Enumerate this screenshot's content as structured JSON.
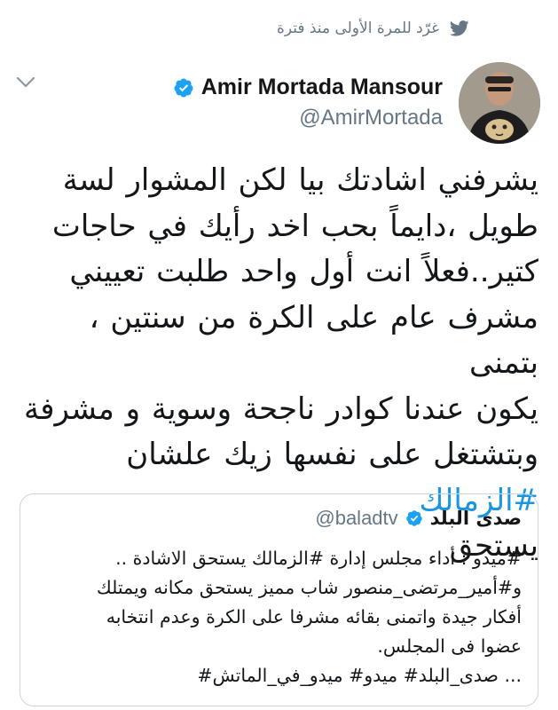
{
  "banner": {
    "text": "غرّد للمرة الأولى منذ فترة",
    "icon": "twitter-bird-icon"
  },
  "author": {
    "name": "Amir Mortada Mansour",
    "handle": "@AmirMortada",
    "verified": true,
    "avatar": "avatar"
  },
  "tweet": {
    "lines": [
      "يشرفني اشادتك بيا لكن المشوار لسة",
      "طويل ،دايماً بحب اخد رأيك في حاجات",
      "كتير..فعلاً انت أول واحد طلبت تعييني",
      "مشرف عام على الكرة من سنتين ، بتمنى",
      "يكون عندنا كوادر ناجحة وسوية و مشرفة"
    ],
    "line6_text": "وبتشتغل على نفسها زيك علشان",
    "line6_hashtag": "#الزمالك",
    "line7": "يستحق"
  },
  "quoted": {
    "name": "صدى البلد",
    "handle": "@baladtv",
    "verified": true,
    "lines": [
      "#ميدو : أداء مجلس إدارة #الزمالك يستحق الاشادة ..",
      "و#أمير_مرتضى_منصور شاب مميز يستحق مكانه ويمتلك",
      "أفكار جيدة واتمنى بقائه مشرفا على الكرة وعدم انتخابه",
      "عضوا فى المجلس.",
      "... صدى_البلد# ميدو# ميدو_في_الماتش#"
    ]
  },
  "colors": {
    "link": "#1b95e0",
    "secondary_text": "#657786",
    "primary_text": "#14171a",
    "border": "#ccd6dd"
  }
}
